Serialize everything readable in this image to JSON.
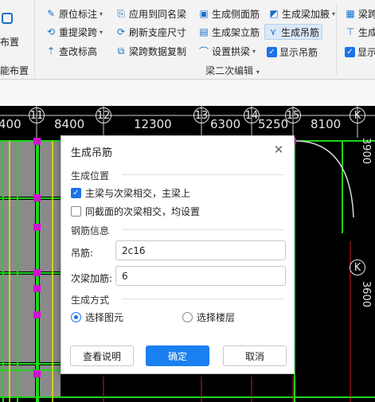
{
  "ribbon": {
    "left_partial_label_top": "布置",
    "left_partial_label_bottom": "能布置",
    "col1": [
      {
        "label": "原位标注",
        "icon": "origin-mark-icon",
        "caret": true
      },
      {
        "label": "重提梁跨",
        "icon": "re-extract-span-icon",
        "caret": true
      },
      {
        "label": "查改标高",
        "icon": "edit-elevation-icon",
        "caret": false
      }
    ],
    "col2": [
      {
        "label": "应用到同名梁",
        "icon": "apply-same-name-icon"
      },
      {
        "label": "刷新支座尺寸",
        "icon": "refresh-support-icon"
      },
      {
        "label": "梁跨数据复制",
        "icon": "copy-span-data-icon"
      }
    ],
    "col3": [
      {
        "label": "生成侧面筋",
        "icon": "side-rebar-icon"
      },
      {
        "label": "生成架立筋",
        "icon": "erection-rebar-icon"
      },
      {
        "label": "设置拱梁",
        "icon": "arch-beam-icon",
        "caret": true
      }
    ],
    "col4": [
      {
        "label": "生成梁加腋",
        "icon": "haunch-icon",
        "caret": true
      },
      {
        "label": "生成吊筋",
        "icon": "hanger-rebar-icon"
      },
      {
        "label": "显示吊筋",
        "icon": "checkbox-checked-icon"
      }
    ],
    "col5_partial": [
      "梁跨",
      "生成",
      "显示"
    ],
    "group_label": "梁二次编辑"
  },
  "canvas": {
    "axis_top": [
      {
        "text": "400"
      },
      {
        "text": "11",
        "circle": true
      },
      {
        "text": "8400"
      },
      {
        "text": "12",
        "circle": true
      },
      {
        "text": "12300"
      },
      {
        "text": "13",
        "circle": true
      },
      {
        "text": "6300"
      },
      {
        "text": "14",
        "circle": true
      },
      {
        "text": "5250"
      },
      {
        "text": "15",
        "circle": true
      },
      {
        "text": "8100"
      },
      {
        "text": "K",
        "circle": true
      }
    ],
    "axis_right_circle": "K",
    "right_vertical_text_1": "3900",
    "right_vertical_text_2": "3600"
  },
  "dialog": {
    "title": "生成吊筋",
    "section_position": "生成位置",
    "opt_main_secondary": "主梁与次梁相交，主梁上",
    "opt_main_secondary_checked": true,
    "opt_same_section": "同截面的次梁相交，均设置",
    "opt_same_section_checked": false,
    "section_rebar": "钢筋信息",
    "hanger_label": "吊筋:",
    "hanger_value": "2c16",
    "secondary_label": "次梁加筋:",
    "secondary_value": "6",
    "section_method": "生成方式",
    "radio_select_element": "选择图元",
    "radio_select_floor": "选择楼层",
    "selected_method": "select_element",
    "btn_help": "查看说明",
    "btn_ok": "确定",
    "btn_cancel": "取消"
  }
}
